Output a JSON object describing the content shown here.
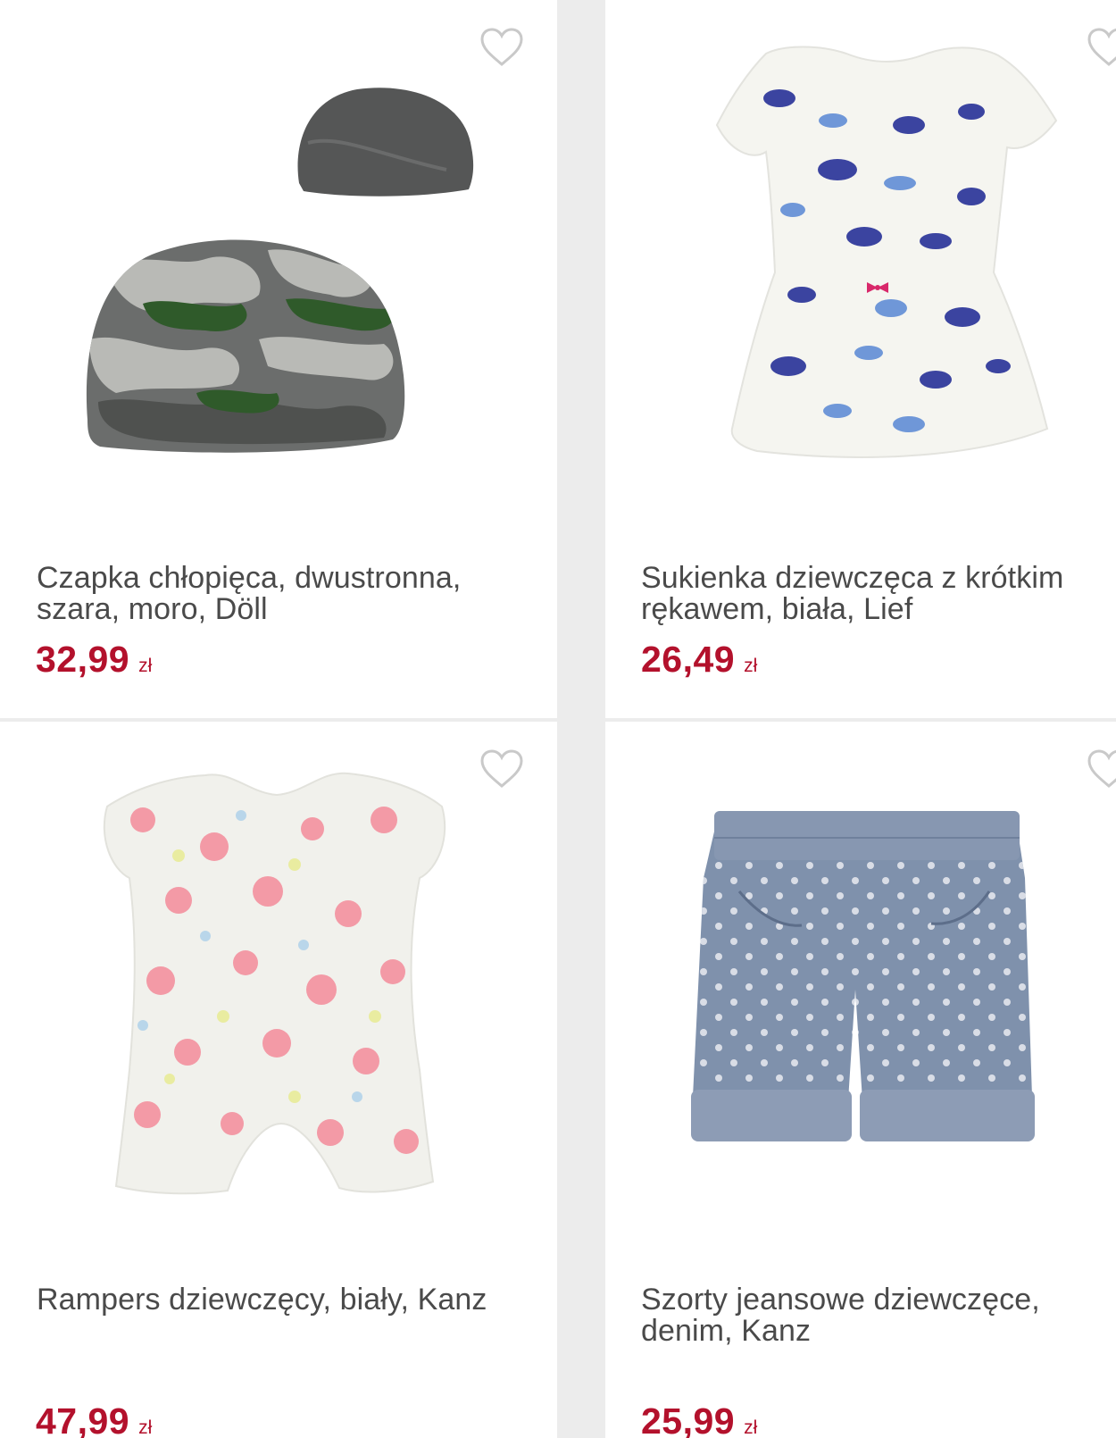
{
  "colors": {
    "price": "#b3112c",
    "heart": "#c9c9c9",
    "title": "#4a4a4a"
  },
  "products": [
    {
      "title": "Czapka chłopięca, dwustronna, szara, moro, Döll",
      "price": "32,99",
      "currency": "zł"
    },
    {
      "title": "Sukienka dziewczęca z krótkim rękawem, biała, Lief",
      "price": "26,49",
      "currency": "zł"
    },
    {
      "title": "Rampers dziewczęcy, biały, Kanz",
      "price": "47,99",
      "currency": "zł"
    },
    {
      "title": "Szorty jeansowe dziewczęce, denim, Kanz",
      "price": "25,99",
      "currency": "zł"
    }
  ],
  "icons": {
    "wishlist": "heart-outline-icon"
  }
}
